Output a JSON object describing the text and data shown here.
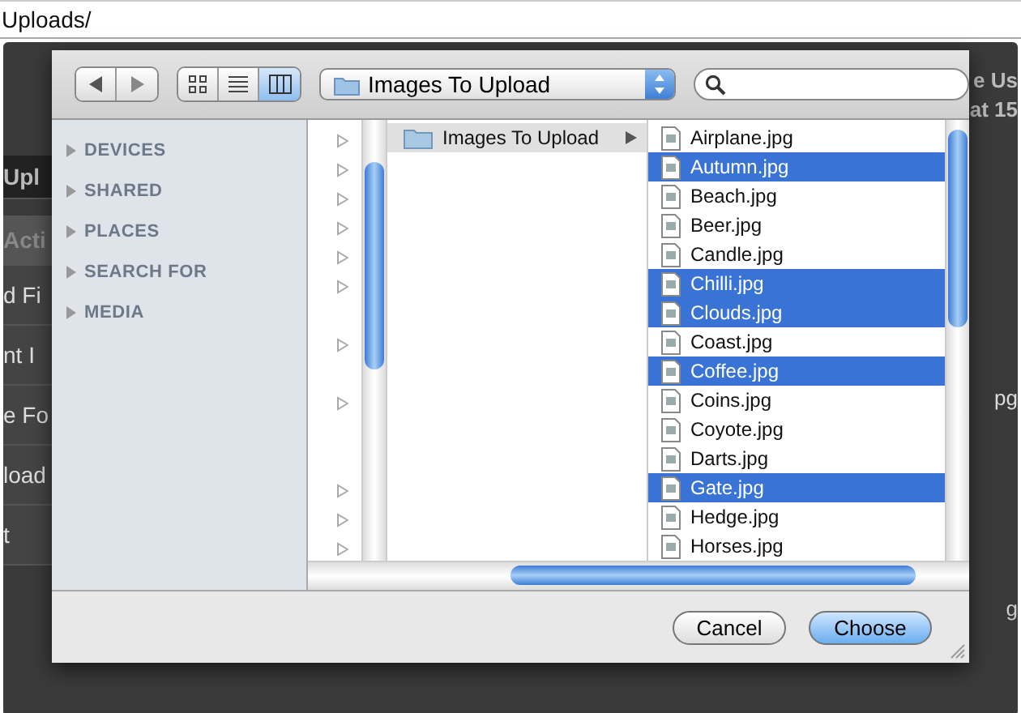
{
  "address_bar": {
    "text": "Uploads/"
  },
  "background_page": {
    "menu": [
      "Upl",
      "Acti",
      "d Fi",
      "nt I",
      "e Fo",
      "load",
      "t"
    ],
    "right_texts": [
      "e Us",
      "at 15",
      "pg",
      "g"
    ]
  },
  "dialog": {
    "toolbar": {
      "views": [
        {
          "kind": "icon",
          "selected": false
        },
        {
          "kind": "list",
          "selected": false
        },
        {
          "kind": "columns",
          "selected": true
        }
      ],
      "location": "Images To Upload"
    },
    "sidebar": [
      {
        "label": "DEVICES",
        "expanded": false
      },
      {
        "label": "SHARED",
        "expanded": false
      },
      {
        "label": "PLACES",
        "expanded": false
      },
      {
        "label": "SEARCH FOR",
        "expanded": false
      },
      {
        "label": "MEDIA",
        "expanded": false
      }
    ],
    "column_2": [
      {
        "name": "Images To Upload",
        "selected": false
      }
    ],
    "files": [
      {
        "name": "Airplane.jpg",
        "selected": false
      },
      {
        "name": "Autumn.jpg",
        "selected": true
      },
      {
        "name": "Beach.jpg",
        "selected": false
      },
      {
        "name": "Beer.jpg",
        "selected": false
      },
      {
        "name": "Candle.jpg",
        "selected": false
      },
      {
        "name": "Chilli.jpg",
        "selected": true
      },
      {
        "name": "Clouds.jpg",
        "selected": true
      },
      {
        "name": "Coast.jpg",
        "selected": false
      },
      {
        "name": "Coffee.jpg",
        "selected": true
      },
      {
        "name": "Coins.jpg",
        "selected": false
      },
      {
        "name": "Coyote.jpg",
        "selected": false
      },
      {
        "name": "Darts.jpg",
        "selected": false
      },
      {
        "name": "Gate.jpg",
        "selected": true
      },
      {
        "name": "Hedge.jpg",
        "selected": false
      },
      {
        "name": "Horses.jpg",
        "selected": false
      }
    ],
    "buttons": [
      {
        "label": "Cancel",
        "kind": "normal"
      },
      {
        "label": "Choose",
        "kind": "default"
      }
    ]
  }
}
